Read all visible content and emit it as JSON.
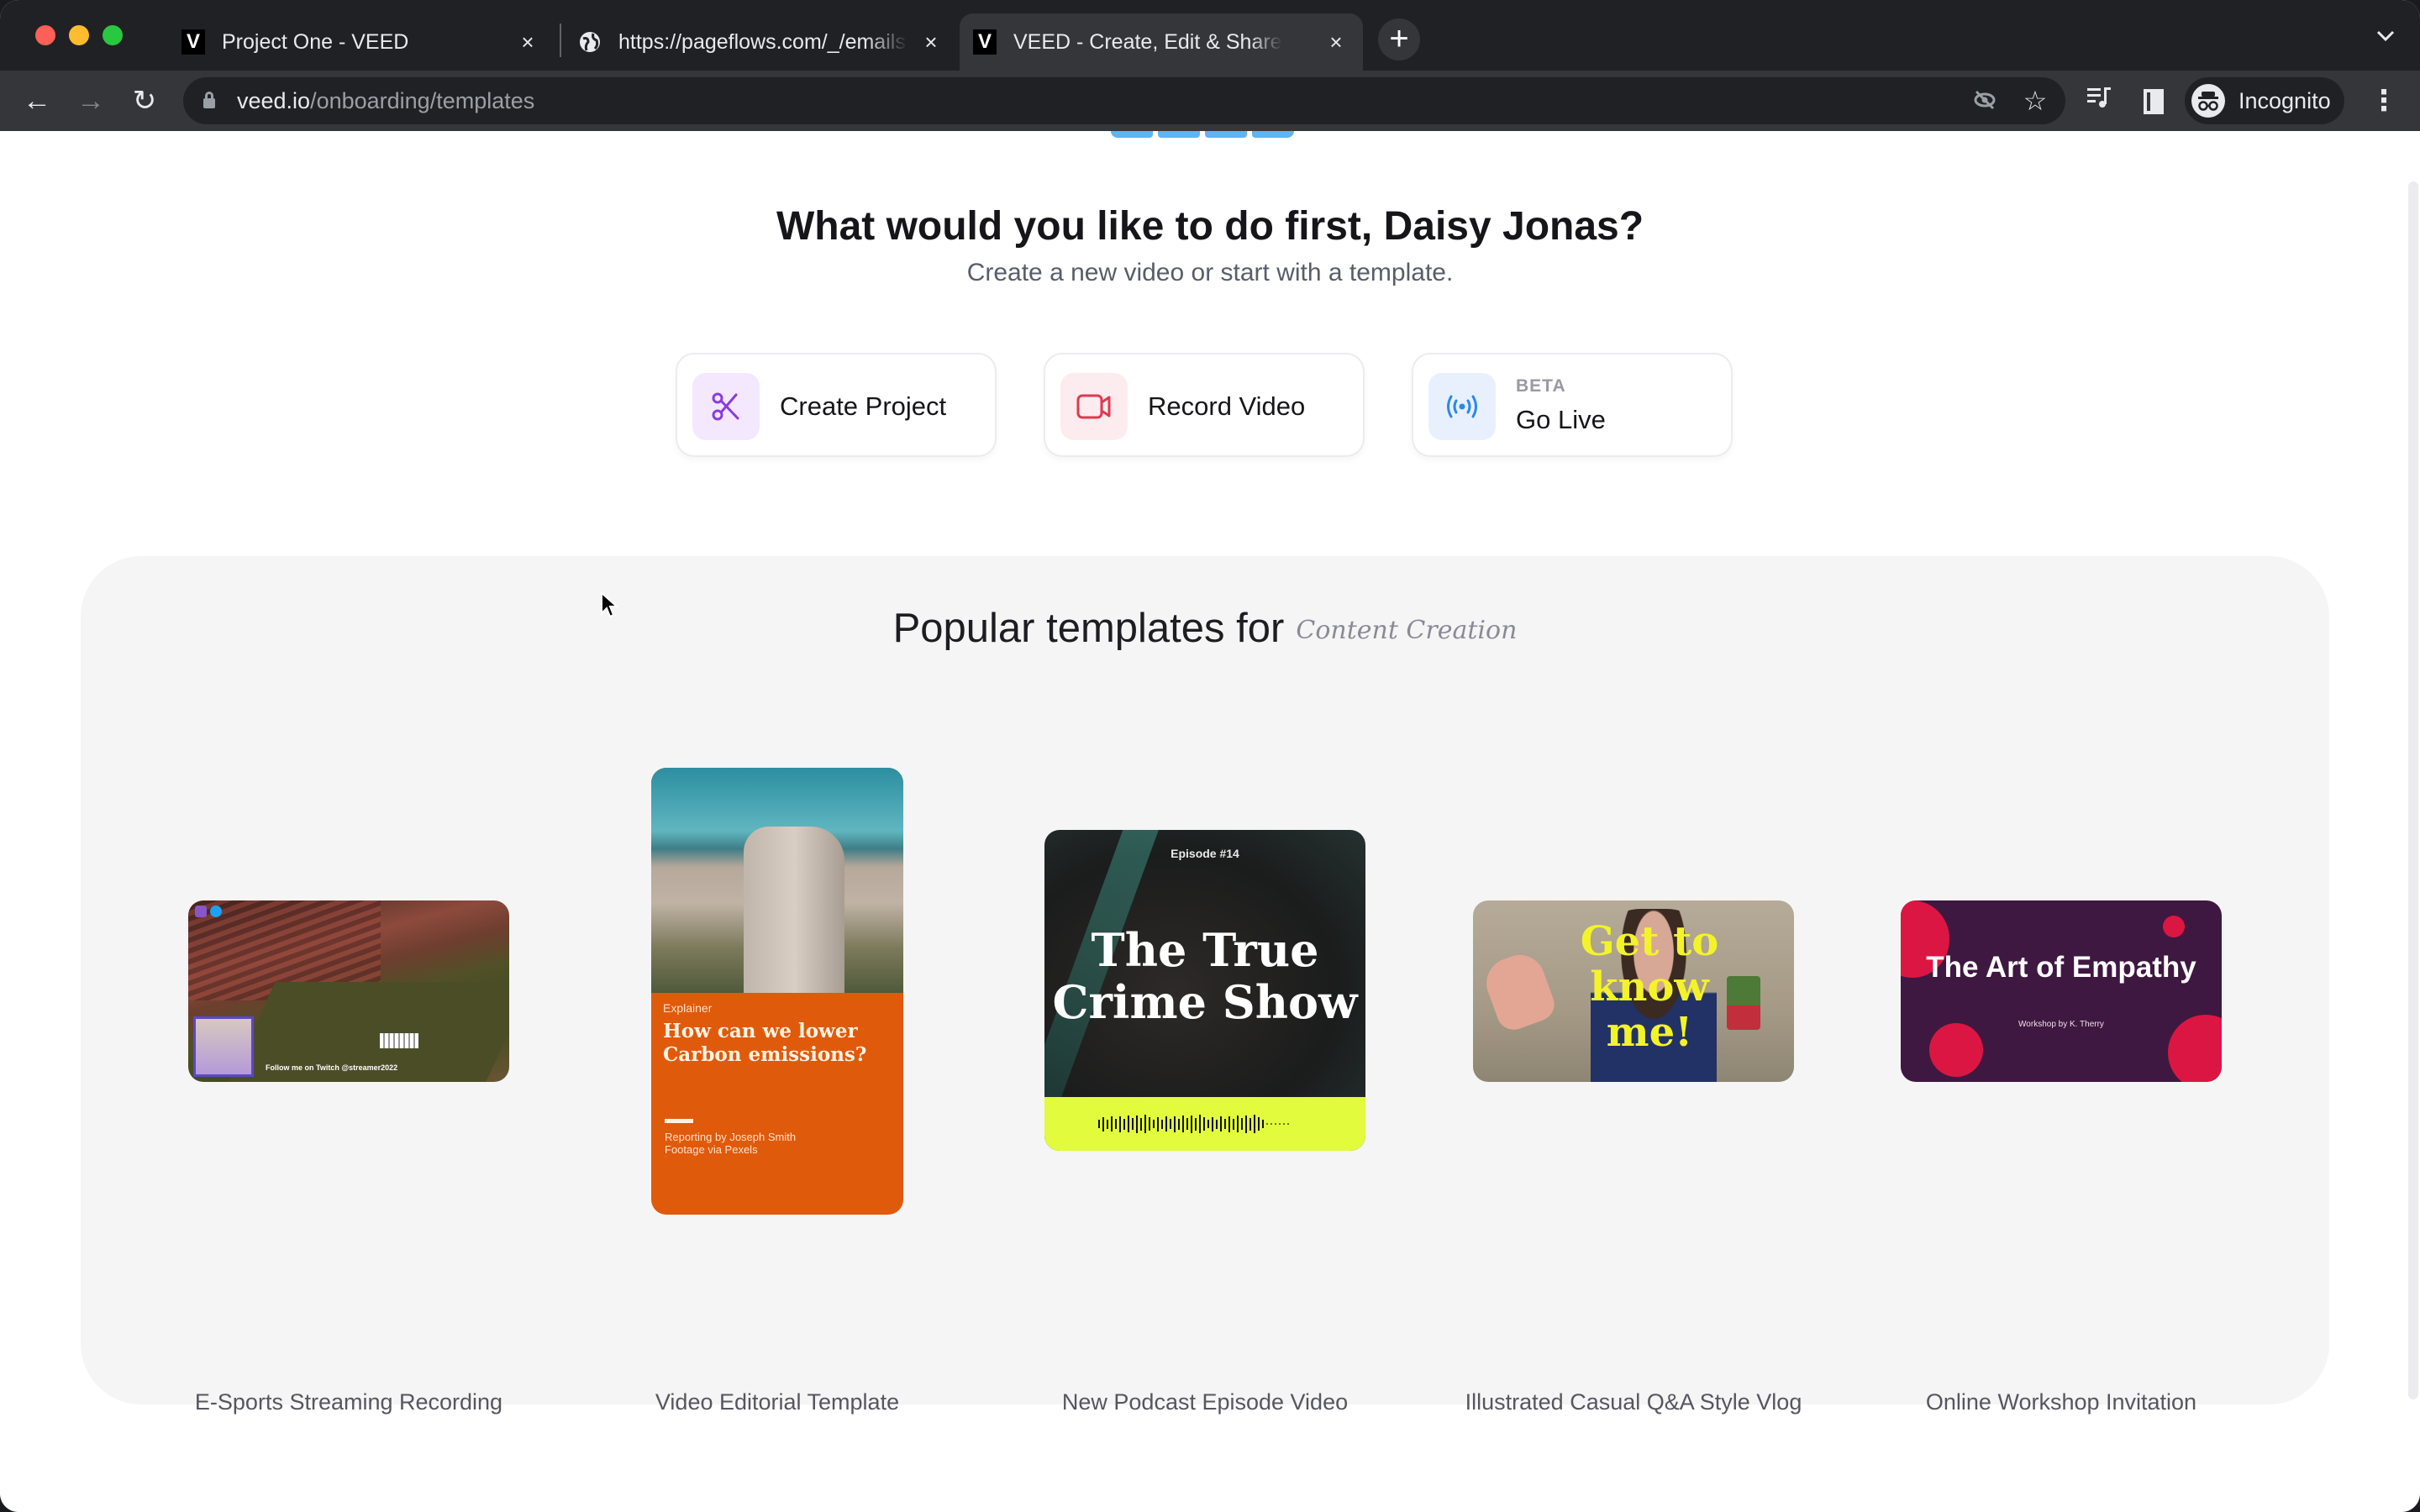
{
  "browser": {
    "tabs": [
      {
        "title": "Project One - VEED",
        "favicon": "veed-logo-icon",
        "active": false
      },
      {
        "title": "https://pageflows.com/_/emails",
        "favicon": "globe-icon",
        "active": false
      },
      {
        "title": "VEED - Create, Edit & Share Videos",
        "favicon": "veed-logo-icon",
        "active": true
      }
    ],
    "favicon_letter": "V",
    "close_glyph": "×",
    "new_tab_glyph": "+",
    "tab_list_glyph": "⌄",
    "url_host": "veed.io",
    "url_path": "/onboarding/templates",
    "profile_label": "Incognito",
    "icons": {
      "back": "←",
      "forward": "→",
      "reload": "↻",
      "eye_off": "⊘",
      "star": "☆",
      "media": "≡♪",
      "incognito": "🕶",
      "menu": "⋮"
    }
  },
  "onboarding": {
    "progress_steps_total": 4,
    "progress_steps_complete": 4,
    "heading": "What would you like to do first, Daisy Jonas?",
    "subheading": "Create a new video or start with a template.",
    "actions": [
      {
        "label": "Create Project",
        "icon": "scissors-icon",
        "badge": ""
      },
      {
        "label": "Record Video",
        "icon": "video-camera-icon",
        "badge": ""
      },
      {
        "label": "Go Live",
        "icon": "broadcast-icon",
        "badge": "BETA"
      }
    ]
  },
  "templates": {
    "title": "Popular templates for",
    "category": "Content Creation",
    "accent_colors": {
      "editorial": "#e05a0b",
      "podcast_bar": "#e2fb3c",
      "workshop_bg": "#3e1840",
      "workshop_dots": "#dc1642",
      "vlog_text": "#f3f32a"
    },
    "items": [
      {
        "name": "E-Sports Streaming Recording",
        "thumb_text": "Follow me on Twitch @streamer2022"
      },
      {
        "name": "Video Editorial Template",
        "thumb_kicker": "Explainer",
        "thumb_title": "How can we lower Carbon emissions?",
        "thumb_credit_1": "Reporting by Joseph Smith",
        "thumb_credit_2": "Footage via Pexels"
      },
      {
        "name": "New Podcast Episode Video",
        "thumb_episode": "Episode #14",
        "thumb_title": "The True Crime Show"
      },
      {
        "name": "Illustrated Casual Q&A Style Vlog",
        "thumb_title": "Get to know me!"
      },
      {
        "name": "Online Workshop Invitation",
        "thumb_title": "The Art of Empathy",
        "thumb_byline": "Workshop by K. Therry"
      }
    ]
  }
}
